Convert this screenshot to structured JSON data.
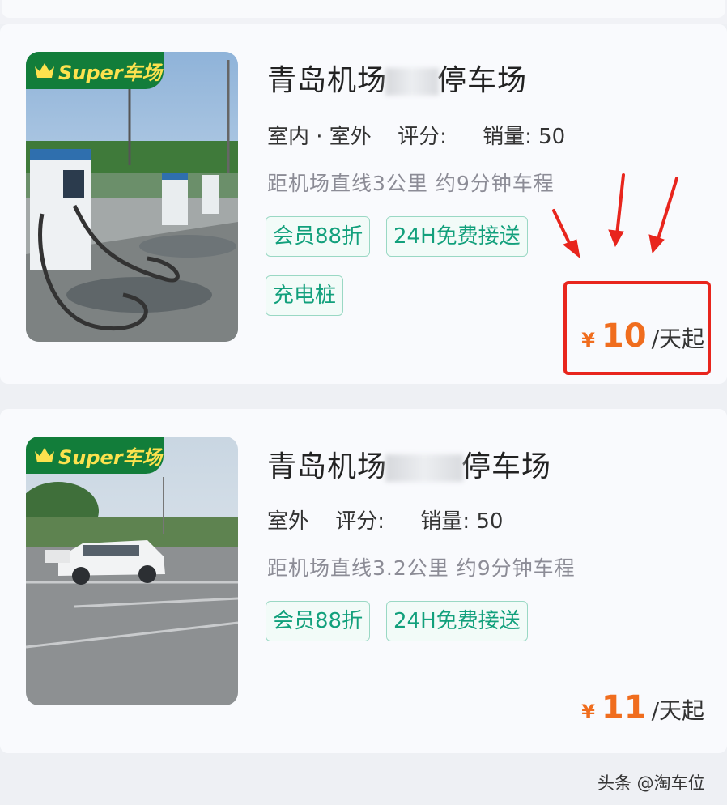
{
  "listings": [
    {
      "badge": "Super车场",
      "title_prefix": "青岛机场",
      "title_suffix": "停车场",
      "location": "室内 · 室外",
      "rating_label": "评分:",
      "sales_label": "销量:",
      "sales_value": "50",
      "distance": "距机场直线3公里 约9分钟车程",
      "tags": [
        "会员88折",
        "24H免费接送",
        "充电桩"
      ],
      "currency": "¥",
      "price": "10",
      "price_unit": "/天起"
    },
    {
      "badge": "Super车场",
      "title_prefix": "青岛机场",
      "title_suffix": "停车场",
      "location": "室外",
      "rating_label": "评分:",
      "sales_label": "销量:",
      "sales_value": "50",
      "distance": "距机场直线3.2公里 约9分钟车程",
      "tags": [
        "会员88折",
        "24H免费接送"
      ],
      "currency": "¥",
      "price": "11",
      "price_unit": "/天起"
    }
  ],
  "watermark": "头条 @淘车位",
  "colors": {
    "accent_green": "#12a07c",
    "badge_green": "#127d3a",
    "price_orange": "#f06d1e",
    "annotation_red": "#e8251d"
  },
  "icons": [
    "crown-icon",
    "red-arrow-icon"
  ]
}
